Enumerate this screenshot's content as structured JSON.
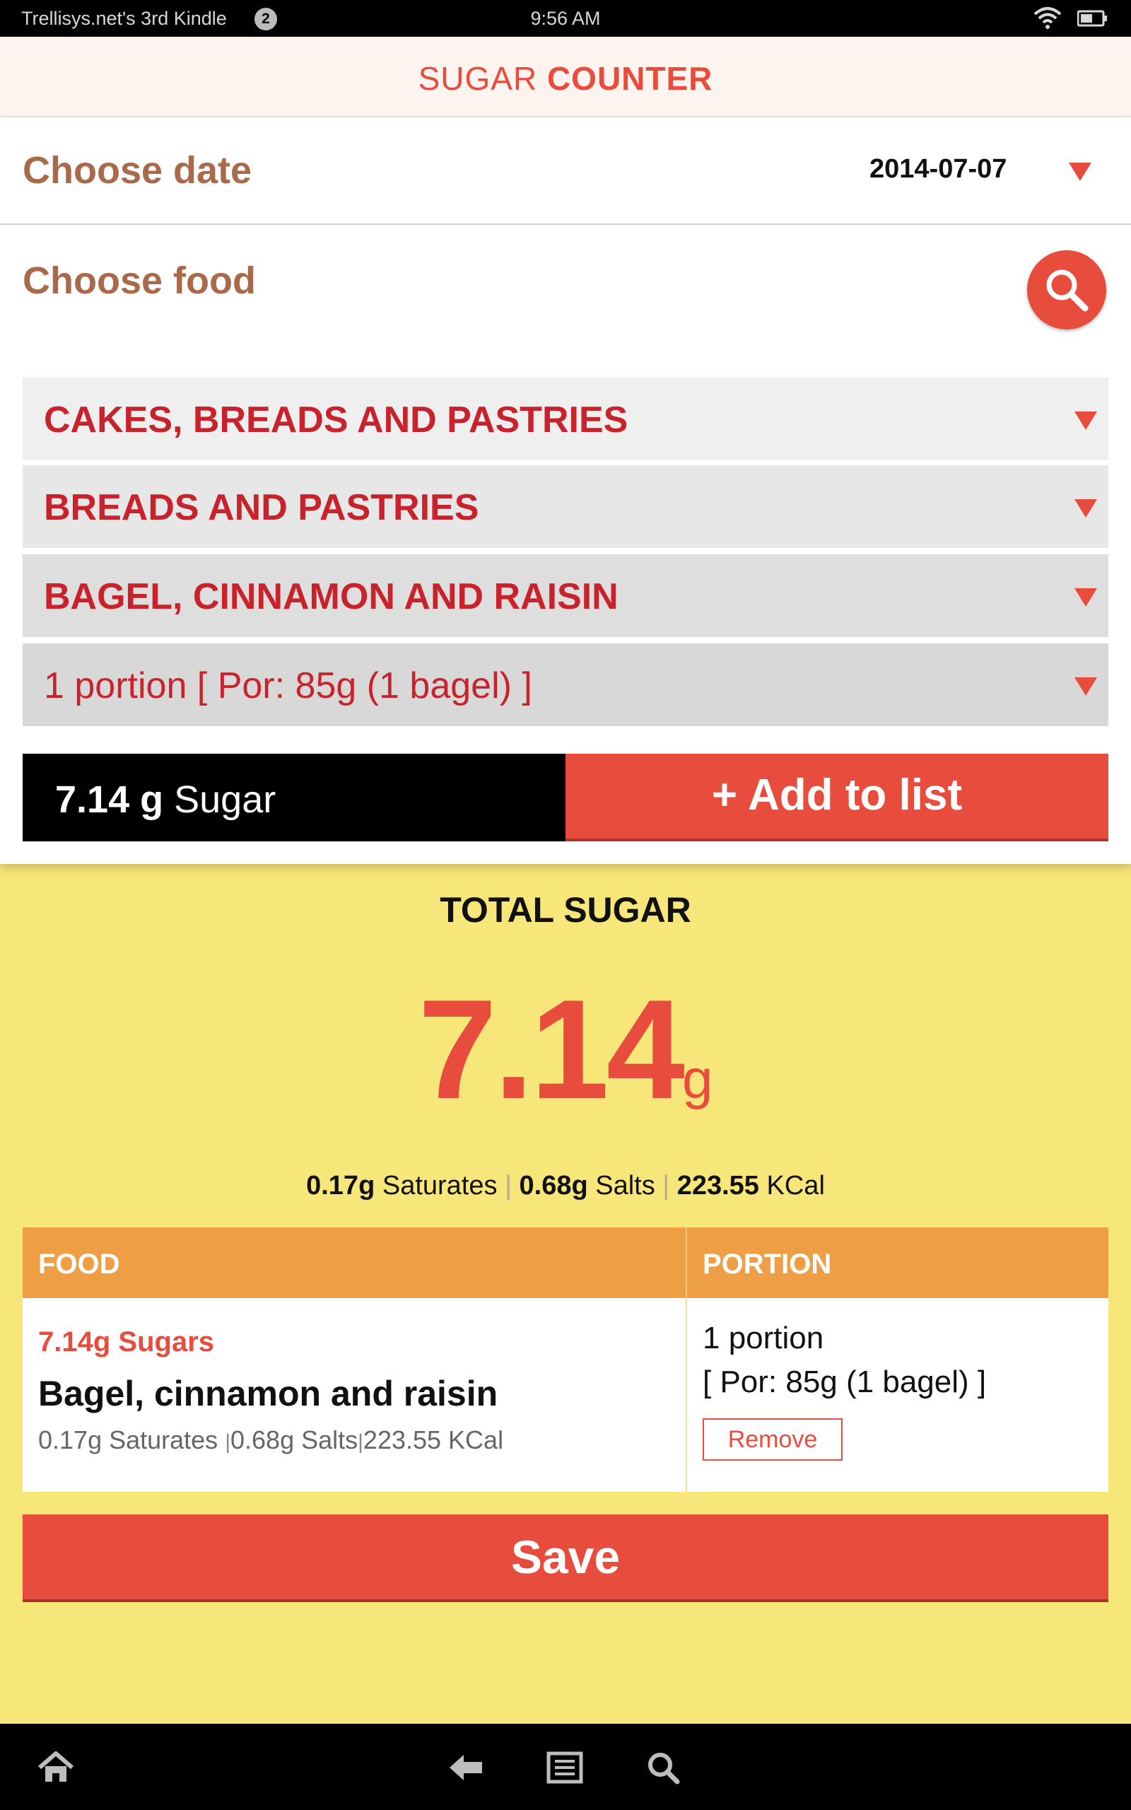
{
  "status_bar": {
    "device_name": "Trellisys.net's 3rd Kindle",
    "notification_count": "2",
    "time": "9:56 AM"
  },
  "app_header": {
    "title_light": "SUGAR",
    "title_bold": "COUNTER"
  },
  "date_section": {
    "label": "Choose date",
    "value": "2014-07-07"
  },
  "food_section": {
    "label": "Choose food",
    "dropdowns": [
      "CAKES, BREADS AND PASTRIES",
      "BREADS AND PASTRIES",
      "BAGEL, CINNAMON AND RAISIN",
      "1 portion [ Por: 85g (1 bagel) ]"
    ]
  },
  "selection": {
    "sugar_amount": "7.14 g",
    "sugar_label": "Sugar",
    "add_button": "+ Add to list"
  },
  "totals": {
    "title": "TOTAL SUGAR",
    "value": "7.14",
    "unit": "g",
    "saturates_value": "0.17g",
    "saturates_label": "Saturates",
    "salts_value": "0.68g",
    "salts_label": "Salts",
    "kcal_value": "223.55",
    "kcal_label": "KCal",
    "separator": "|"
  },
  "table": {
    "headers": {
      "food": "FOOD",
      "portion": "PORTION"
    },
    "rows": [
      {
        "sugars": "7.14g Sugars",
        "name": "Bagel, cinnamon and raisin",
        "saturates": "0.17g Saturates",
        "salts": "0.68g Salts",
        "kcal": "223.55 KCal",
        "portion_line1": "1 portion",
        "portion_line2": "[ Por: 85g (1 bagel) ]",
        "remove_label": "Remove"
      }
    ]
  },
  "save_button": "Save",
  "icons": {
    "wifi": "wifi-icon",
    "battery": "battery-icon",
    "search": "search-icon",
    "dropdown": "triangle-down-icon",
    "home": "home-icon",
    "back": "back-arrow-icon",
    "menu": "menu-icon",
    "nav_search": "search-icon"
  },
  "colors": {
    "accent_red": "#e84c3d",
    "dropdown_text": "#c8232c",
    "label_brown": "#a9694a",
    "background_yellow": "#f7e67a",
    "table_header_orange": "#ee9e44"
  }
}
